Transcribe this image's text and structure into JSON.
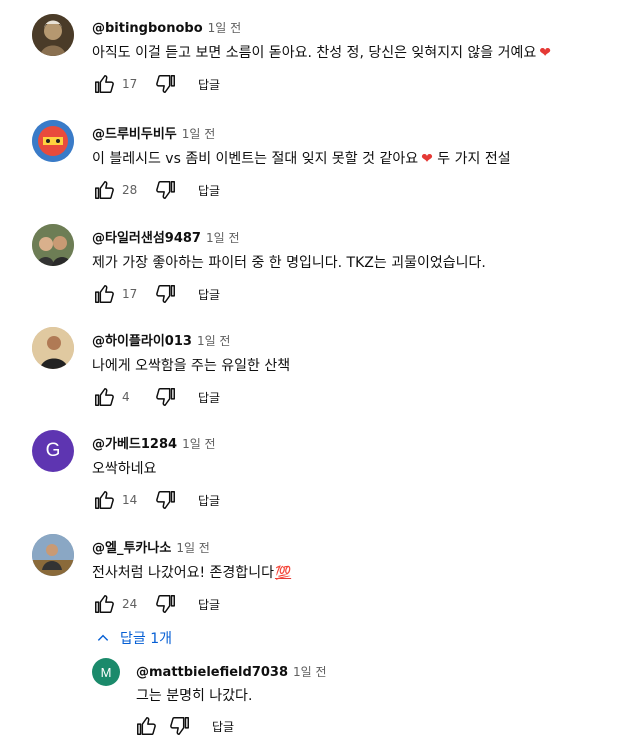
{
  "comments": [
    {
      "author": "@bitingbonobo",
      "time": "1일 전",
      "text": "아직도 이걸 듣고 보면 소름이 돋아요. 찬성 정, 당신은 잊혀지지 않을 거예요",
      "emoji": "❤",
      "likes": "17",
      "reply_label": "답글",
      "avatar_color": "#6b5a3a"
    },
    {
      "author": "@드루비두비두",
      "time": "1일 전",
      "text": "이 블레시드 vs 좀비 이벤트는 절대 잊지 못할 것 같아요",
      "emoji": "❤",
      "text_after": " 두 가지 전설",
      "likes": "28",
      "reply_label": "답글",
      "avatar_color": "#e94b3c"
    },
    {
      "author": "@타일러샌섬9487",
      "time": "1일 전",
      "text": "제가 가장 좋아하는 파이터 중 한 명입니다. TKZ는 괴물이었습니다.",
      "likes": "17",
      "reply_label": "답글",
      "avatar_color": "#7a8a5a"
    },
    {
      "author": "@하이플라이013",
      "time": "1일 전",
      "text": "나에게 오싹함을 주는 유일한 산책",
      "likes": "4",
      "reply_label": "답글",
      "avatar_color": "#c9a97a"
    },
    {
      "author": "@가베드1284",
      "time": "1일 전",
      "text": "오싹하네요",
      "likes": "14",
      "reply_label": "답글",
      "avatar_letter": "G",
      "avatar_color": "#5e35b1"
    },
    {
      "author": "@엘_투카나소",
      "time": "1일 전",
      "text": "전사처럼 나갔어요! 존경합니다",
      "emoji": "💯",
      "likes": "24",
      "reply_label": "답글",
      "avatar_color": "#5a7a9a"
    }
  ],
  "replies_toggle": {
    "label": "답글 1개"
  },
  "reply": {
    "author": "@mattbielefield7038",
    "time": "1일 전",
    "text": "그는 분명히 나갔다.",
    "likes": "",
    "reply_label": "답글",
    "avatar_letter": "M",
    "avatar_color": "#1b8a6b"
  }
}
